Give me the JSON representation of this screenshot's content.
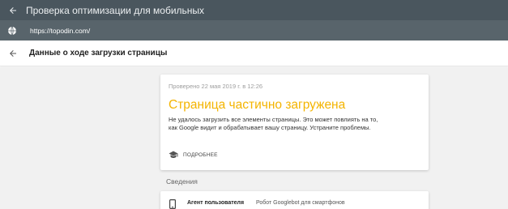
{
  "topbar": {
    "title": "Проверка оптимизации для мобильных",
    "back_icon": "arrow-left-icon"
  },
  "urlbar": {
    "url": "https://topodin.com/",
    "icon": "globe-icon"
  },
  "subheader": {
    "title": "Данные о ходе загрузки страницы",
    "back_icon": "arrow-left-icon"
  },
  "result_card": {
    "checked_text": "Проверено 22 мая 2019 г. в 12:26",
    "status_title": "Страница частично загружена",
    "description": "Не удалось загрузить все элементы страницы. Это может повлиять на то, как Google видит и обрабатывает вашу страницу. Устраните проблемы.",
    "more_label": "ПОДРОБНЕЕ",
    "more_icon": "graduation-cap-icon"
  },
  "details": {
    "section_label": "Сведения",
    "rows": [
      {
        "icon": "phone-icon",
        "key": "Агент пользователя",
        "value": "Робот Googlebot для смартфонов"
      }
    ]
  },
  "colors": {
    "topbar": "#4a565e",
    "urlbar": "#58646b",
    "status": "#f4b400",
    "background": "#f1f1f1"
  }
}
